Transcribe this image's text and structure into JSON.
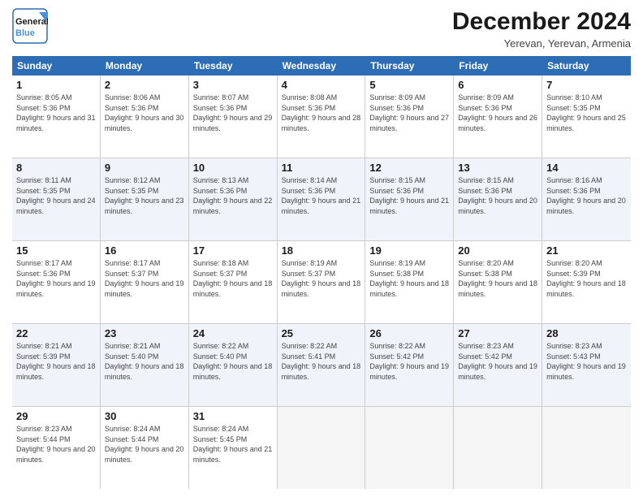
{
  "logo": {
    "line1": "General",
    "line2": "Blue"
  },
  "title": "December 2024",
  "location": "Yerevan, Yerevan, Armenia",
  "days_of_week": [
    "Sunday",
    "Monday",
    "Tuesday",
    "Wednesday",
    "Thursday",
    "Friday",
    "Saturday"
  ],
  "rows": [
    [
      {
        "day": "1",
        "sunrise": "8:05 AM",
        "sunset": "5:36 PM",
        "daylight": "9 hours and 31 minutes."
      },
      {
        "day": "2",
        "sunrise": "8:06 AM",
        "sunset": "5:36 PM",
        "daylight": "9 hours and 30 minutes."
      },
      {
        "day": "3",
        "sunrise": "8:07 AM",
        "sunset": "5:36 PM",
        "daylight": "9 hours and 29 minutes."
      },
      {
        "day": "4",
        "sunrise": "8:08 AM",
        "sunset": "5:36 PM",
        "daylight": "9 hours and 28 minutes."
      },
      {
        "day": "5",
        "sunrise": "8:09 AM",
        "sunset": "5:36 PM",
        "daylight": "9 hours and 27 minutes."
      },
      {
        "day": "6",
        "sunrise": "8:09 AM",
        "sunset": "5:36 PM",
        "daylight": "9 hours and 26 minutes."
      },
      {
        "day": "7",
        "sunrise": "8:10 AM",
        "sunset": "5:35 PM",
        "daylight": "9 hours and 25 minutes."
      }
    ],
    [
      {
        "day": "8",
        "sunrise": "8:11 AM",
        "sunset": "5:35 PM",
        "daylight": "9 hours and 24 minutes."
      },
      {
        "day": "9",
        "sunrise": "8:12 AM",
        "sunset": "5:35 PM",
        "daylight": "9 hours and 23 minutes."
      },
      {
        "day": "10",
        "sunrise": "8:13 AM",
        "sunset": "5:36 PM",
        "daylight": "9 hours and 22 minutes."
      },
      {
        "day": "11",
        "sunrise": "8:14 AM",
        "sunset": "5:36 PM",
        "daylight": "9 hours and 21 minutes."
      },
      {
        "day": "12",
        "sunrise": "8:15 AM",
        "sunset": "5:36 PM",
        "daylight": "9 hours and 21 minutes."
      },
      {
        "day": "13",
        "sunrise": "8:15 AM",
        "sunset": "5:36 PM",
        "daylight": "9 hours and 20 minutes."
      },
      {
        "day": "14",
        "sunrise": "8:16 AM",
        "sunset": "5:36 PM",
        "daylight": "9 hours and 20 minutes."
      }
    ],
    [
      {
        "day": "15",
        "sunrise": "8:17 AM",
        "sunset": "5:36 PM",
        "daylight": "9 hours and 19 minutes."
      },
      {
        "day": "16",
        "sunrise": "8:17 AM",
        "sunset": "5:37 PM",
        "daylight": "9 hours and 19 minutes."
      },
      {
        "day": "17",
        "sunrise": "8:18 AM",
        "sunset": "5:37 PM",
        "daylight": "9 hours and 18 minutes."
      },
      {
        "day": "18",
        "sunrise": "8:19 AM",
        "sunset": "5:37 PM",
        "daylight": "9 hours and 18 minutes."
      },
      {
        "day": "19",
        "sunrise": "8:19 AM",
        "sunset": "5:38 PM",
        "daylight": "9 hours and 18 minutes."
      },
      {
        "day": "20",
        "sunrise": "8:20 AM",
        "sunset": "5:38 PM",
        "daylight": "9 hours and 18 minutes."
      },
      {
        "day": "21",
        "sunrise": "8:20 AM",
        "sunset": "5:39 PM",
        "daylight": "9 hours and 18 minutes."
      }
    ],
    [
      {
        "day": "22",
        "sunrise": "8:21 AM",
        "sunset": "5:39 PM",
        "daylight": "9 hours and 18 minutes."
      },
      {
        "day": "23",
        "sunrise": "8:21 AM",
        "sunset": "5:40 PM",
        "daylight": "9 hours and 18 minutes."
      },
      {
        "day": "24",
        "sunrise": "8:22 AM",
        "sunset": "5:40 PM",
        "daylight": "9 hours and 18 minutes."
      },
      {
        "day": "25",
        "sunrise": "8:22 AM",
        "sunset": "5:41 PM",
        "daylight": "9 hours and 18 minutes."
      },
      {
        "day": "26",
        "sunrise": "8:22 AM",
        "sunset": "5:42 PM",
        "daylight": "9 hours and 19 minutes."
      },
      {
        "day": "27",
        "sunrise": "8:23 AM",
        "sunset": "5:42 PM",
        "daylight": "9 hours and 19 minutes."
      },
      {
        "day": "28",
        "sunrise": "8:23 AM",
        "sunset": "5:43 PM",
        "daylight": "9 hours and 19 minutes."
      }
    ],
    [
      {
        "day": "29",
        "sunrise": "8:23 AM",
        "sunset": "5:44 PM",
        "daylight": "9 hours and 20 minutes."
      },
      {
        "day": "30",
        "sunrise": "8:24 AM",
        "sunset": "5:44 PM",
        "daylight": "9 hours and 20 minutes."
      },
      {
        "day": "31",
        "sunrise": "8:24 AM",
        "sunset": "5:45 PM",
        "daylight": "9 hours and 21 minutes."
      },
      null,
      null,
      null,
      null
    ]
  ],
  "alt_rows": [
    1,
    3
  ],
  "labels": {
    "sunrise": "Sunrise: ",
    "sunset": "Sunset: ",
    "daylight": "Daylight: "
  }
}
